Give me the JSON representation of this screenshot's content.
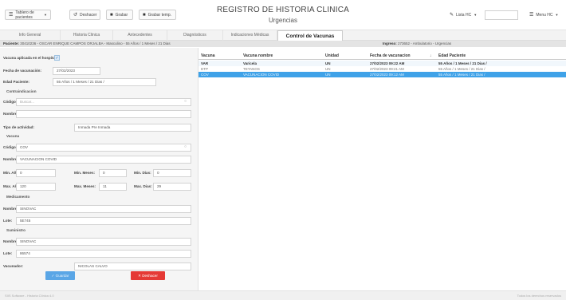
{
  "toolbar": {
    "patients_board_label": "Tablero de pacientes",
    "undo_label": "Deshacer",
    "save_label": "Grabar",
    "save_temp_label": "Grabar temp.",
    "list_hc_label": "Lista HC",
    "menu_hc_label": "Menu HC"
  },
  "header": {
    "title": "REGISTRO DE HISTORIA CLINICA",
    "subtitle": "Urgencias"
  },
  "tabs": [
    {
      "label": "Info General"
    },
    {
      "label": "Historia Clinica"
    },
    {
      "label": "Antecedentes"
    },
    {
      "label": "Diagnósticos"
    },
    {
      "label": "Indicaciones Médicas"
    },
    {
      "label": "Control de Vacunas"
    }
  ],
  "patient": {
    "label": "Paciente:",
    "value": "30410236 - OSCAR ENRIQUE CAMPOS ORJALBA - Masculino - 55 Años / 1 Meses / 21 Dias",
    "ingreso_label": "Ingreso:",
    "ingreso_value": "273652 - Ambulatorio - Urgencias"
  },
  "form": {
    "vacuna_hospital_label": "Vacuna aplicada en el hospital",
    "fecha_label": "Fecha de vacunación:",
    "fecha_value": "27/02/2023",
    "edad_label": "Edad Paciente:",
    "edad_value": "55 Años / 1 Meses / 21 Dias /",
    "contraindicacion_section": "Contraindicacion",
    "ci_codigo_label": "Código:",
    "ci_codigo_placeholder": "Buscar...",
    "ci_nombre_label": "Nombre:",
    "tipo_actividad_label": "Tipo de actividad:",
    "tipo_actividad_value": "Inmada Pre Inmada",
    "vacuna_section": "Vacuna",
    "v_codigo_label": "Código: *",
    "v_codigo_value": "COV",
    "v_nombre_label": "Nombre:",
    "v_nombre_value": "VACUNACION COVID",
    "min_anos_label": "Min. Años:",
    "min_anos_value": "0",
    "min_meses_label": "Min. Meses:",
    "min_meses_value": "0",
    "min_dias_label": "Min. Dias:",
    "min_dias_value": "0",
    "max_anos_label": "Max. Años:",
    "max_anos_value": "120",
    "max_meses_label": "Max. Meses:",
    "max_meses_value": "11",
    "max_dias_label": "Max. Dias:",
    "max_dias_value": "29",
    "medicamento_section": "Medicamento",
    "med_nombre_label": "Nombre:",
    "med_nombre_value": "SINOVAC",
    "med_lote_label": "Lote:",
    "med_lote_value": "5E745",
    "suministro_section": "Suministro",
    "sum_nombre_label": "Nombre:",
    "sum_nombre_value": "SINOVAC",
    "sum_lote_label": "Lote:",
    "sum_lote_value": "86574",
    "vacunador_label": "Vacunador:",
    "vacunador_value": "NICOLAS CALVO",
    "save_button": "Guardar",
    "undo_button": "Deshacer"
  },
  "table": {
    "headers": [
      "Vacuna",
      "Vacuna nombre",
      "Unidad",
      "Fecha de vacunacion",
      "Edad Paciente"
    ],
    "rows": [
      [
        "VAR",
        "Varicela",
        "UN",
        "27/02/2023 09:22 AM",
        "55 Años / 1 Meses / 21 Dias /"
      ],
      [
        "DTP",
        "TETANOS",
        "UN",
        "27/02/2023 09:21 AM",
        "55 Años / 1 Meses / 21 Dias /"
      ],
      [
        "COV",
        "VACUNACION COVID",
        "UN",
        "27/02/2023 09:12 AM",
        "55 Años / 1 Meses / 21 Dias /"
      ]
    ]
  },
  "footer": {
    "left": "SIIS Software - Historia Clínica 4.0",
    "right": "Todos los derechos reservados"
  },
  "colors": {
    "accent": "#3fa2e8",
    "danger": "#e53935",
    "save_button": "#5aa6e6"
  }
}
